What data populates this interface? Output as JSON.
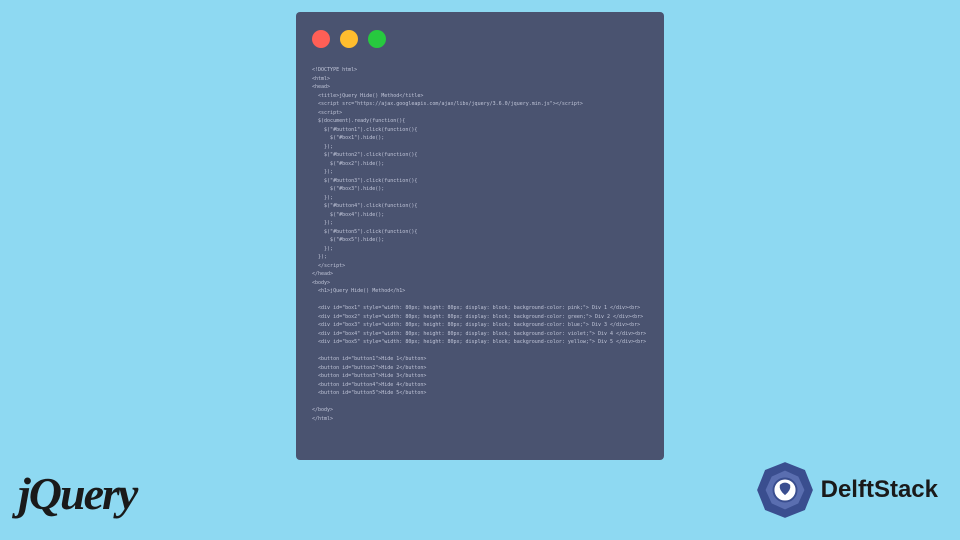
{
  "code": {
    "lines": [
      "<!DOCTYPE html>",
      "<html>",
      "<head>",
      "  <title>jQuery Hide() Method</title>",
      "  <script src=\"https://ajax.googleapis.com/ajax/libs/jquery/3.6.0/jquery.min.js\"></script>",
      "  <script>",
      "  $(document).ready(function(){",
      "    $(\"#button1\").click(function(){",
      "      $(\"#box1\").hide();",
      "    });",
      "    $(\"#button2\").click(function(){",
      "      $(\"#box2\").hide();",
      "    });",
      "    $(\"#button3\").click(function(){",
      "      $(\"#box3\").hide();",
      "    });",
      "    $(\"#button4\").click(function(){",
      "      $(\"#box4\").hide();",
      "    });",
      "    $(\"#button5\").click(function(){",
      "      $(\"#box5\").hide();",
      "    });",
      "  });",
      "  </script>",
      "</head>",
      "<body>",
      "  <h1>jQuery Hide() Method</h1>",
      "",
      "  <div id=\"box1\" style=\"width: 80px; height: 80px; display: block; background-color: pink;\"> Div 1 </div><br>",
      "  <div id=\"box2\" style=\"width: 80px; height: 80px; display: block; background-color: green;\"> Div 2 </div><br>",
      "  <div id=\"box3\" style=\"width: 80px; height: 80px; display: block; background-color: blue;\"> Div 3 </div><br>",
      "  <div id=\"box4\" style=\"width: 80px; height: 80px; display: block; background-color: violet;\"> Div 4 </div><br>",
      "  <div id=\"box5\" style=\"width: 80px; height: 80px; display: block; background-color: yellow;\"> Div 5 </div><br>",
      "",
      "  <button id=\"button1\">Hide 1</button>",
      "  <button id=\"button2\">Hide 2</button>",
      "  <button id=\"button3\">Hide 3</button>",
      "  <button id=\"button4\">Hide 4</button>",
      "  <button id=\"button5\">Hide 5</button>",
      "",
      "</body>",
      "</html>"
    ]
  },
  "logos": {
    "jquery": "jQuery",
    "delftstack": "DelftStack"
  }
}
